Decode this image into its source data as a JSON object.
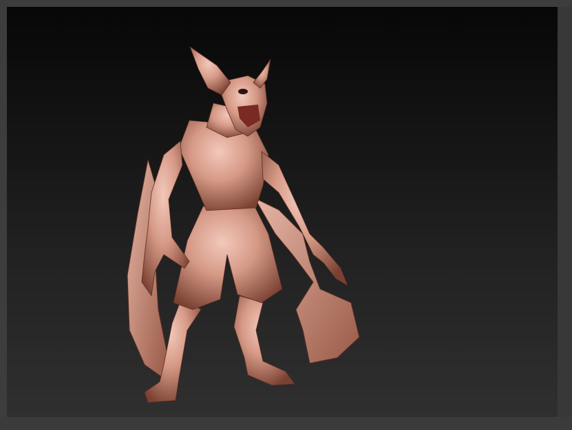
{
  "app": {
    "viewport": {
      "background_top": "#070707",
      "background_bottom": "#2f2f2f"
    },
    "model": {
      "subject": "bat-creature-sculpt",
      "material_color": "#c98a78",
      "highlight_color": "#f2c8bb",
      "shadow_color": "#6a3a2e"
    }
  }
}
